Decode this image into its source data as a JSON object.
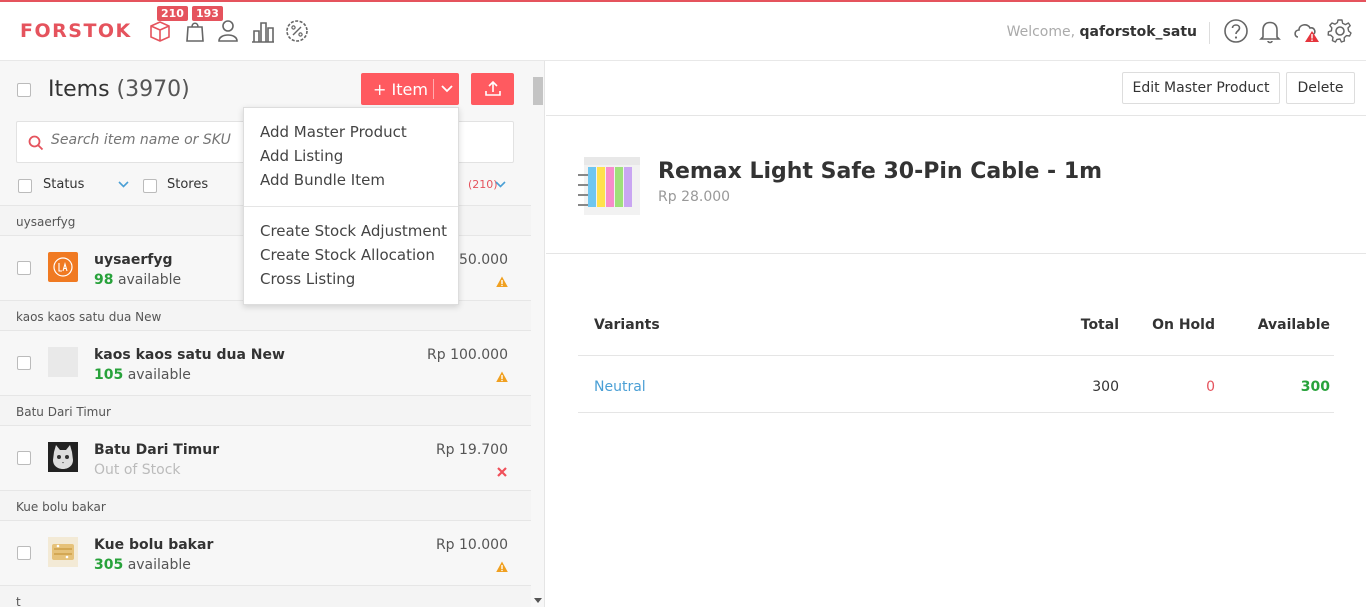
{
  "header": {
    "logo": "FORSTOK",
    "badges": {
      "items": "210",
      "orders": "193"
    },
    "welcome_prefix": "Welcome,",
    "username": "qaforstok_satu",
    "icons": [
      "box-icon",
      "bag-icon",
      "user-icon",
      "chart-icon",
      "discount-icon",
      "help-icon",
      "bell-icon",
      "cloud-alert-icon",
      "gear-icon"
    ]
  },
  "items_panel": {
    "title": "Items",
    "count": "(3970)",
    "add_button": "+ Item",
    "search_placeholder": "Search item name or SKU",
    "filters": {
      "status": "Status",
      "stores": "Stores",
      "count": "(210)"
    },
    "groups": [
      {
        "header": "uysaerfyg",
        "name": "uysaerfyg",
        "stock_value": "98",
        "stock_text": "available",
        "price": "50.000",
        "status": "warning",
        "thumb": "laz-logo"
      },
      {
        "header": "kaos kaos satu dua New",
        "name": "kaos kaos satu dua New",
        "stock_value": "105",
        "stock_text": "available",
        "price": "Rp 100.000",
        "status": "warning",
        "thumb": "blank"
      },
      {
        "header": "Batu Dari Timur",
        "name": "Batu Dari Timur",
        "stock_value": "",
        "stock_text": "Out of Stock",
        "price": "Rp 19.700",
        "status": "error",
        "thumb": "cat"
      },
      {
        "header": "Kue bolu bakar",
        "name": "Kue bolu bakar",
        "stock_value": "305",
        "stock_text": "available",
        "price": "Rp 10.000",
        "status": "warning",
        "thumb": "cake"
      }
    ],
    "last_group_header": "t"
  },
  "dropdown": {
    "items": [
      "Add Master Product",
      "Add Listing",
      "Add Bundle Item",
      "Create Stock Adjustment",
      "Create Stock Allocation",
      "Cross Listing"
    ]
  },
  "detail": {
    "edit_button": "Edit Master Product",
    "delete_button": "Delete",
    "product_title": "Remax Light Safe 30-Pin Cable - 1m",
    "product_price": "Rp 28.000",
    "table_headers": {
      "variants": "Variants",
      "total": "Total",
      "on_hold": "On Hold",
      "available": "Available"
    },
    "variants": [
      {
        "name": "Neutral",
        "total": "300",
        "on_hold": "0",
        "available": "300"
      }
    ]
  },
  "colors": {
    "brand": "#e5535d",
    "button": "#ff5a60",
    "available_green": "#28a23b",
    "link_blue": "#4a9fd5",
    "warning": "#f0a020"
  }
}
